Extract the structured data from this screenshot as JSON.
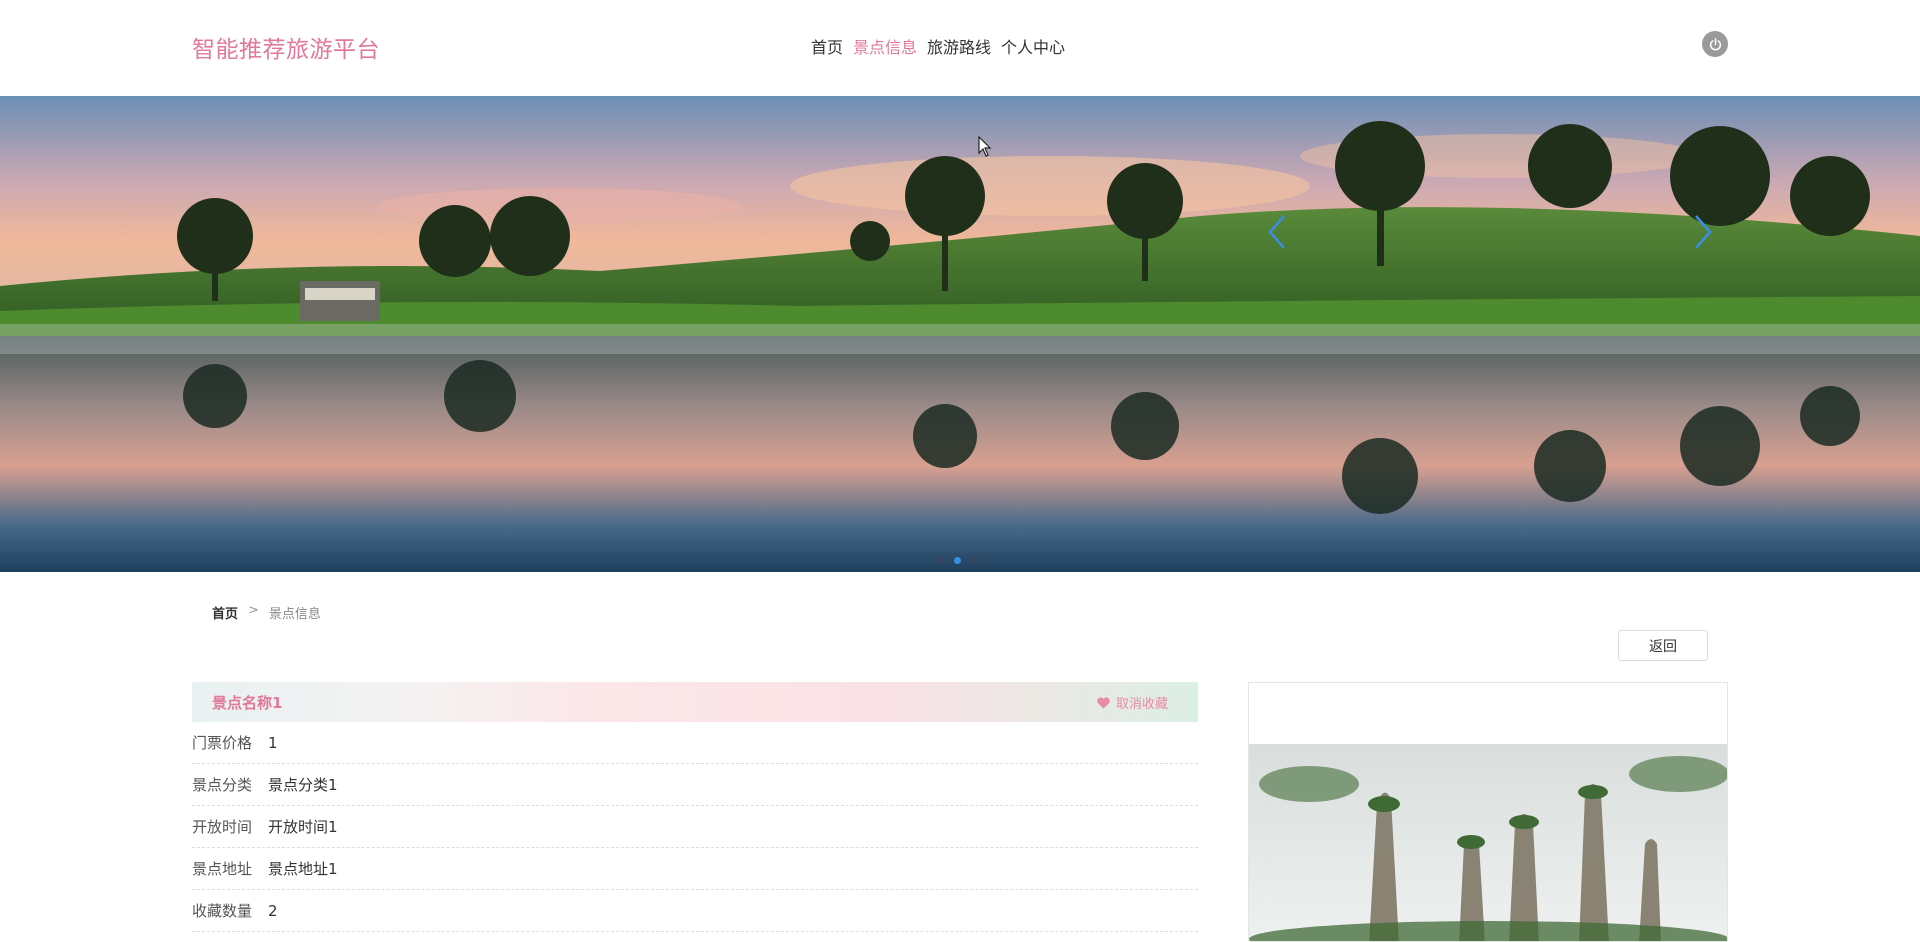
{
  "header": {
    "logo": "智能推荐旅游平台",
    "nav": [
      {
        "label": "首页",
        "active": false
      },
      {
        "label": "景点信息",
        "active": true
      },
      {
        "label": "旅游路线",
        "active": false
      },
      {
        "label": "个人中心",
        "active": false
      }
    ],
    "power_icon": "power-icon"
  },
  "banner": {
    "slides": 3,
    "active_slide": 2
  },
  "breadcrumb": {
    "home": "首页",
    "separator": ">",
    "current": "景点信息"
  },
  "actions": {
    "back_label": "返回"
  },
  "detail": {
    "title": "景点名称1",
    "favorite_label": "取消收藏",
    "fields": [
      {
        "label": "门票价格",
        "value": "1"
      },
      {
        "label": "景点分类",
        "value": "景点分类1"
      },
      {
        "label": "开放时间",
        "value": "开放时间1"
      },
      {
        "label": "景点地址",
        "value": "景点地址1"
      },
      {
        "label": "收藏数量",
        "value": "2"
      }
    ]
  },
  "colors": {
    "accent": "#e2789a",
    "carousel_arrow": "#3a8ee6"
  }
}
